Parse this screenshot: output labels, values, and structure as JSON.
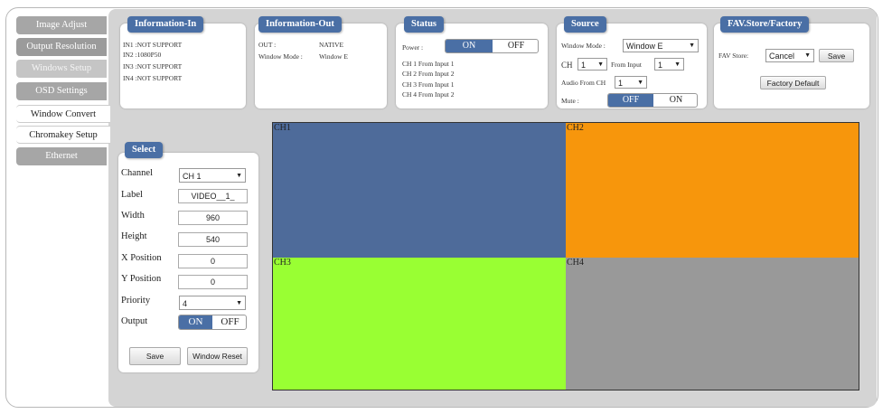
{
  "sidebar": {
    "tabs": [
      {
        "label": "Image Adjust",
        "state": "normal"
      },
      {
        "label": "Output Resolution",
        "state": "normal"
      },
      {
        "label": "Windows Setup",
        "state": "disabled"
      },
      {
        "label": "OSD Settings",
        "state": "normal"
      },
      {
        "label": "Window Convert",
        "state": "active"
      },
      {
        "label": "Chromakey Setup",
        "state": "active"
      },
      {
        "label": "Ethernet",
        "state": "normal"
      }
    ]
  },
  "info_in": {
    "title": "Information-In",
    "lines": [
      "IN1 :NOT SUPPORT",
      "IN2 :1080P50",
      "IN3 :NOT SUPPORT",
      "IN4 :NOT SUPPORT"
    ]
  },
  "info_out": {
    "title": "Information-Out",
    "out_label": "OUT :",
    "out_value": "NATIVE",
    "mode_label": "Window Mode :",
    "mode_value": "Window E"
  },
  "status": {
    "title": "Status",
    "power_label": "Power :",
    "on_label": "ON",
    "off_label": "OFF",
    "power_state": "ON",
    "lines": [
      "CH 1 From Input  1",
      "CH 2 From Input  2",
      "CH 3 From Input  1",
      "CH 4 From Input  2"
    ]
  },
  "source": {
    "title": "Source",
    "window_mode_label": "Window Mode :",
    "window_mode_value": "Window E",
    "ch_label": "CH",
    "ch_value": "1",
    "from_input_label": "From Input",
    "from_input_value": "1",
    "audio_label": "Audio From CH",
    "audio_value": "1",
    "mute_label": "Mute :",
    "off_label": "OFF",
    "on_label": "ON",
    "mute_state": "OFF"
  },
  "fav": {
    "title": "FAV.Store/Factory",
    "store_label": "FAV Store:",
    "store_value": "Cancel",
    "save_label": "Save",
    "factory_label": "Factory Default"
  },
  "select": {
    "title": "Select",
    "channel_label": "Channel",
    "channel_value": "CH 1",
    "label_label": "Label",
    "label_value": "VIDEO__1_",
    "width_label": "Width",
    "width_value": "960",
    "height_label": "Height",
    "height_value": "540",
    "xpos_label": "X Position",
    "xpos_value": "0",
    "ypos_label": "Y Position",
    "ypos_value": "0",
    "priority_label": "Priority",
    "priority_value": "4",
    "output_label": "Output",
    "on_label": "ON",
    "off_label": "OFF",
    "output_state": "ON",
    "save_label": "Save",
    "reset_label": "Window Reset"
  },
  "preview": {
    "channels": [
      {
        "label": "CH1",
        "color": "#4e6b9a"
      },
      {
        "label": "CH2",
        "color": "#f7960c"
      },
      {
        "label": "CH3",
        "color": "#99ff33"
      },
      {
        "label": "CH4",
        "color": "#999999"
      }
    ]
  },
  "colors": {
    "accent": "#4a6fa5"
  }
}
